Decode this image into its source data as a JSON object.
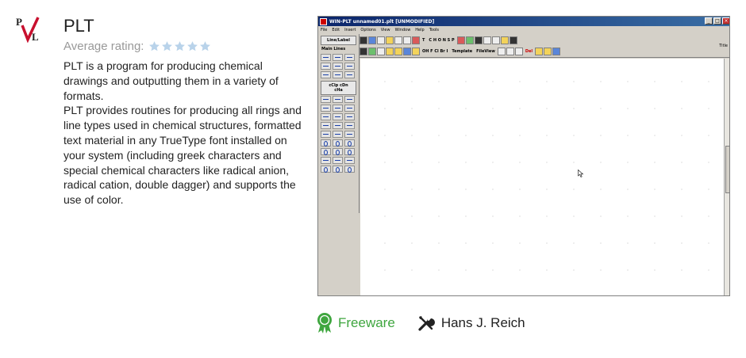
{
  "app": {
    "name": "PLT",
    "logo_text": "PVL",
    "rating_label": "Average rating:",
    "rating_stars": 5,
    "rating_filled": 0,
    "star_color": "#b9d3ea",
    "description": [
      "PLT is a program for producing chemical drawings and outputting them in a variety of formats.",
      "PLT provides routines for producing all rings and line types used in chemical structures, formatted text material in any TrueType font installed on your system (including greek characters and special chemical characters like radical anion, radical cation, double dagger) and supports the use of color."
    ]
  },
  "screenshot": {
    "window_title": "WIN-PLT  unnamed01.plt  [UNMODIFIED]",
    "window_buttons": [
      "_",
      "□",
      "×"
    ],
    "menu": [
      "File",
      "Edit",
      "Insert",
      "Options",
      "View",
      "Window",
      "Help",
      "Tools"
    ],
    "toolbar_labels": {
      "chem_letters": "C H O N S P",
      "chem_letters2": "OH F Cl Br I",
      "template": "Template",
      "fileview": "FileView",
      "del": "Del",
      "title_right": "Title"
    },
    "side_panel": {
      "line_label": "Line/Label",
      "main_lines": "Main Lines",
      "clip_label": "cClp cDn cHa"
    },
    "accent_color": "#0a246a"
  },
  "meta": {
    "license": "Freeware",
    "license_color": "#3fa63f",
    "author": "Hans J. Reich"
  }
}
